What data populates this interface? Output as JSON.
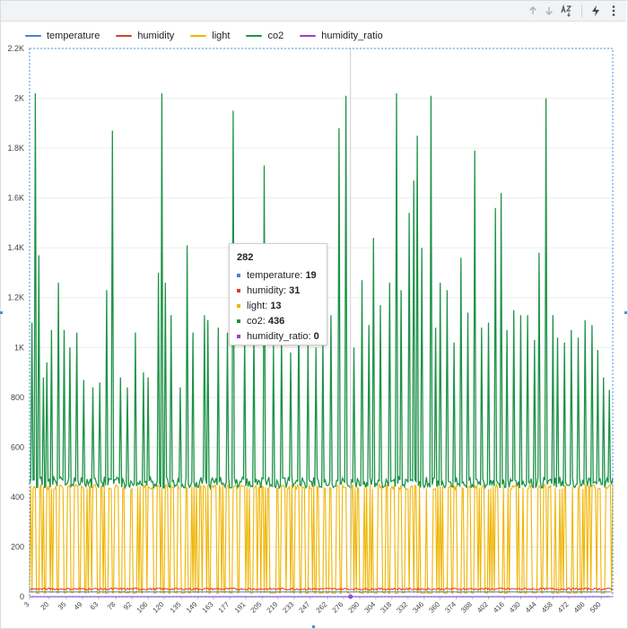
{
  "toolbar": {
    "icons": [
      "arrow-up-icon",
      "arrow-down-icon",
      "sort-az-icon",
      "lightning-icon",
      "more-vert-icon"
    ]
  },
  "colors": {
    "temperature": "#4a7fd6",
    "humidity": "#d6402f",
    "light": "#f0b400",
    "co2": "#1e9348",
    "humidity_ratio": "#9c3fcf"
  },
  "chart_data": {
    "type": "line",
    "ylim": [
      0,
      2200
    ],
    "yticks": [
      "0",
      "200",
      "400",
      "600",
      "800",
      "1K",
      "1.2K",
      "1.4K",
      "1.6K",
      "1.8K",
      "2K",
      "2.2K"
    ],
    "xlim": [
      3,
      510
    ],
    "xticks": [
      3,
      20,
      35,
      49,
      63,
      78,
      92,
      106,
      120,
      135,
      149,
      163,
      177,
      191,
      205,
      219,
      233,
      247,
      262,
      276,
      290,
      304,
      318,
      332,
      346,
      360,
      374,
      388,
      402,
      416,
      430,
      444,
      458,
      472,
      486,
      500
    ],
    "legend_position": "top-left",
    "grid": true,
    "series": [
      {
        "name": "temperature",
        "baseline": 19
      },
      {
        "name": "humidity",
        "baseline": 31
      },
      {
        "name": "light",
        "baseline": 13,
        "peak": 450
      },
      {
        "name": "co2",
        "baseline": 436,
        "peaks": [
          [
            5,
            1100
          ],
          [
            8,
            2020
          ],
          [
            11,
            1370
          ],
          [
            15,
            880
          ],
          [
            18,
            940
          ],
          [
            22,
            1070
          ],
          [
            28,
            1260
          ],
          [
            33,
            1070
          ],
          [
            38,
            1000
          ],
          [
            44,
            1060
          ],
          [
            50,
            870
          ],
          [
            58,
            840
          ],
          [
            64,
            860
          ],
          [
            70,
            1230
          ],
          [
            75,
            1870
          ],
          [
            82,
            880
          ],
          [
            88,
            840
          ],
          [
            95,
            1060
          ],
          [
            102,
            900
          ],
          [
            106,
            880
          ],
          [
            115,
            1300
          ],
          [
            118,
            2020
          ],
          [
            121,
            1260
          ],
          [
            126,
            1130
          ],
          [
            134,
            840
          ],
          [
            140,
            1410
          ],
          [
            145,
            1060
          ],
          [
            155,
            1130
          ],
          [
            158,
            1110
          ],
          [
            167,
            1080
          ],
          [
            175,
            1060
          ],
          [
            180,
            1950
          ],
          [
            190,
            1060
          ],
          [
            198,
            1080
          ],
          [
            207,
            1730
          ],
          [
            215,
            1010
          ],
          [
            222,
            1060
          ],
          [
            230,
            980
          ],
          [
            237,
            1130
          ],
          [
            245,
            1030
          ],
          [
            252,
            1000
          ],
          [
            258,
            1040
          ],
          [
            265,
            1130
          ],
          [
            272,
            1880
          ],
          [
            278,
            2010
          ],
          [
            285,
            1000
          ],
          [
            292,
            1270
          ],
          [
            298,
            1090
          ],
          [
            302,
            1440
          ],
          [
            308,
            1170
          ],
          [
            316,
            1260
          ],
          [
            322,
            2020
          ],
          [
            326,
            1230
          ],
          [
            333,
            1540
          ],
          [
            337,
            1670
          ],
          [
            340,
            1850
          ],
          [
            344,
            1400
          ],
          [
            352,
            2010
          ],
          [
            356,
            1080
          ],
          [
            360,
            1260
          ],
          [
            366,
            1230
          ],
          [
            372,
            1020
          ],
          [
            378,
            1360
          ],
          [
            384,
            1140
          ],
          [
            390,
            1790
          ],
          [
            396,
            1080
          ],
          [
            402,
            1100
          ],
          [
            408,
            1560
          ],
          [
            413,
            1620
          ],
          [
            418,
            1070
          ],
          [
            424,
            1150
          ],
          [
            430,
            1130
          ],
          [
            436,
            1130
          ],
          [
            442,
            1030
          ],
          [
            446,
            1380
          ],
          [
            452,
            2000
          ],
          [
            458,
            1130
          ],
          [
            462,
            1040
          ],
          [
            468,
            1020
          ],
          [
            474,
            1070
          ],
          [
            480,
            1040
          ],
          [
            486,
            1110
          ],
          [
            492,
            1090
          ],
          [
            497,
            990
          ],
          [
            502,
            880
          ],
          [
            507,
            830
          ]
        ]
      },
      {
        "name": "humidity_ratio",
        "baseline": 0
      }
    ],
    "hover": {
      "x": 282,
      "items": [
        {
          "name": "temperature",
          "value": "19"
        },
        {
          "name": "humidity",
          "value": "31"
        },
        {
          "name": "light",
          "value": "13"
        },
        {
          "name": "co2",
          "value": "436"
        },
        {
          "name": "humidity_ratio",
          "value": "0"
        }
      ]
    }
  }
}
